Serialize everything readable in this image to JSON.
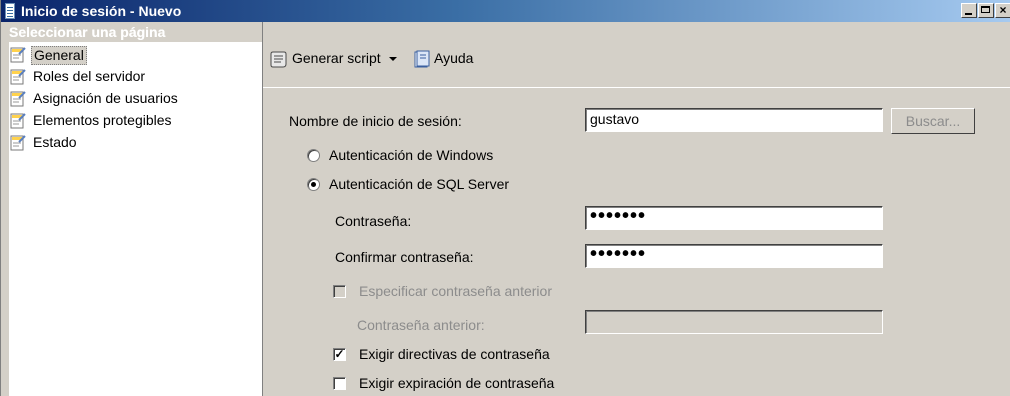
{
  "window": {
    "title": "Inicio de sesión - Nuevo",
    "controls": [
      "minimize",
      "maximize",
      "close"
    ]
  },
  "sidebar": {
    "header": "Seleccionar una página",
    "items": [
      {
        "label": "General",
        "selected": true,
        "icon": "page-wrench-icon"
      },
      {
        "label": "Roles del servidor",
        "selected": false,
        "icon": "page-wrench-icon"
      },
      {
        "label": "Asignación de usuarios",
        "selected": false,
        "icon": "page-wrench-icon"
      },
      {
        "label": "Elementos protegibles",
        "selected": false,
        "icon": "page-wrench-icon"
      },
      {
        "label": "Estado",
        "selected": false,
        "icon": "page-wrench-icon"
      }
    ]
  },
  "toolbar": {
    "script_label": "Generar script",
    "help_label": "Ayuda"
  },
  "form": {
    "login_name_label": "Nombre de inicio de sesión:",
    "login_name_value": "gustavo",
    "search_button": "Buscar...",
    "auth_windows": "Autenticación de Windows",
    "auth_sql": "Autenticación de SQL Server",
    "auth_selected": "sql",
    "password_label": "Contraseña:",
    "password_value": "•••••••",
    "confirm_label": "Confirmar contraseña:",
    "confirm_value": "•••••••",
    "specify_old_label": "Especificar contraseña anterior",
    "old_password_label": "Contraseña anterior:",
    "old_password_value": "",
    "enforce_policy_label": "Exigir directivas de contraseña",
    "enforce_policy_checked": true,
    "enforce_expiration_label": "Exigir expiración de contraseña",
    "enforce_expiration_checked": false
  }
}
